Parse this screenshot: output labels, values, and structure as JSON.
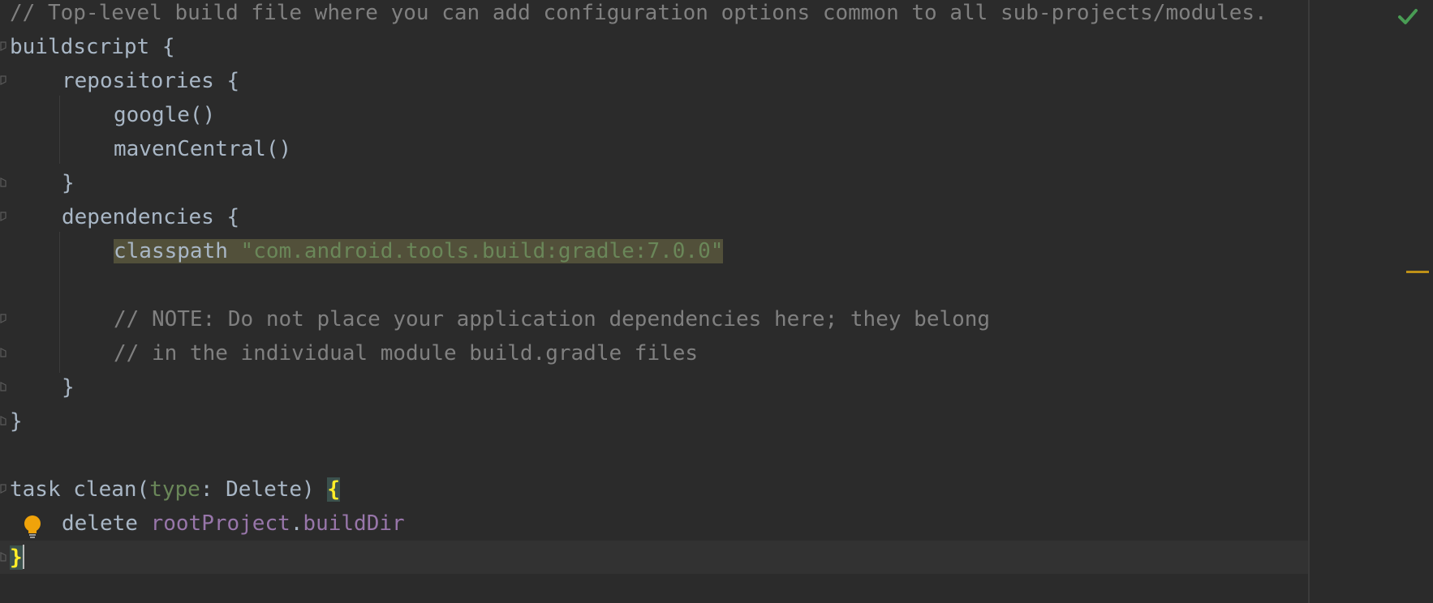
{
  "editor": {
    "file_comment": "// Top-level build file where you can add configuration options common to all sub-projects/modules.",
    "lines": {
      "buildscript_open": "buildscript {",
      "repositories_open": "repositories {",
      "google": "google()",
      "maven_central": "mavenCentral()",
      "repositories_close": "}",
      "dependencies_open": "dependencies {",
      "classpath_keyword": "classpath",
      "classpath_value": "\"com.android.tools.build:gradle:7.0.0\"",
      "note_comment_1": "// NOTE: Do not place your application dependencies here; they belong",
      "note_comment_2": "// in the individual module build.gradle files",
      "dependencies_close": "}",
      "buildscript_close": "}",
      "task_prefix": "task clean(",
      "task_param_name": "type",
      "task_param_sep": ": Delete) ",
      "task_open_brace": "{",
      "delete_keyword": "delete ",
      "root_project": "rootProject",
      "dot": ".",
      "build_dir": "buildDir",
      "task_close_brace": "}"
    },
    "status": {
      "inspection_state": "no-problems",
      "icon": "check-icon",
      "check_color": "#499c54",
      "warning_stripe_color": "#be9117"
    },
    "intention": {
      "icon": "lightbulb-icon",
      "color": "#f0a30a"
    },
    "colors": {
      "background": "#2b2b2b",
      "text": "#a9b7c6",
      "comment": "#808080",
      "string": "#6a8759",
      "property": "#9876aa",
      "brace_match": "#ffef28"
    }
  }
}
